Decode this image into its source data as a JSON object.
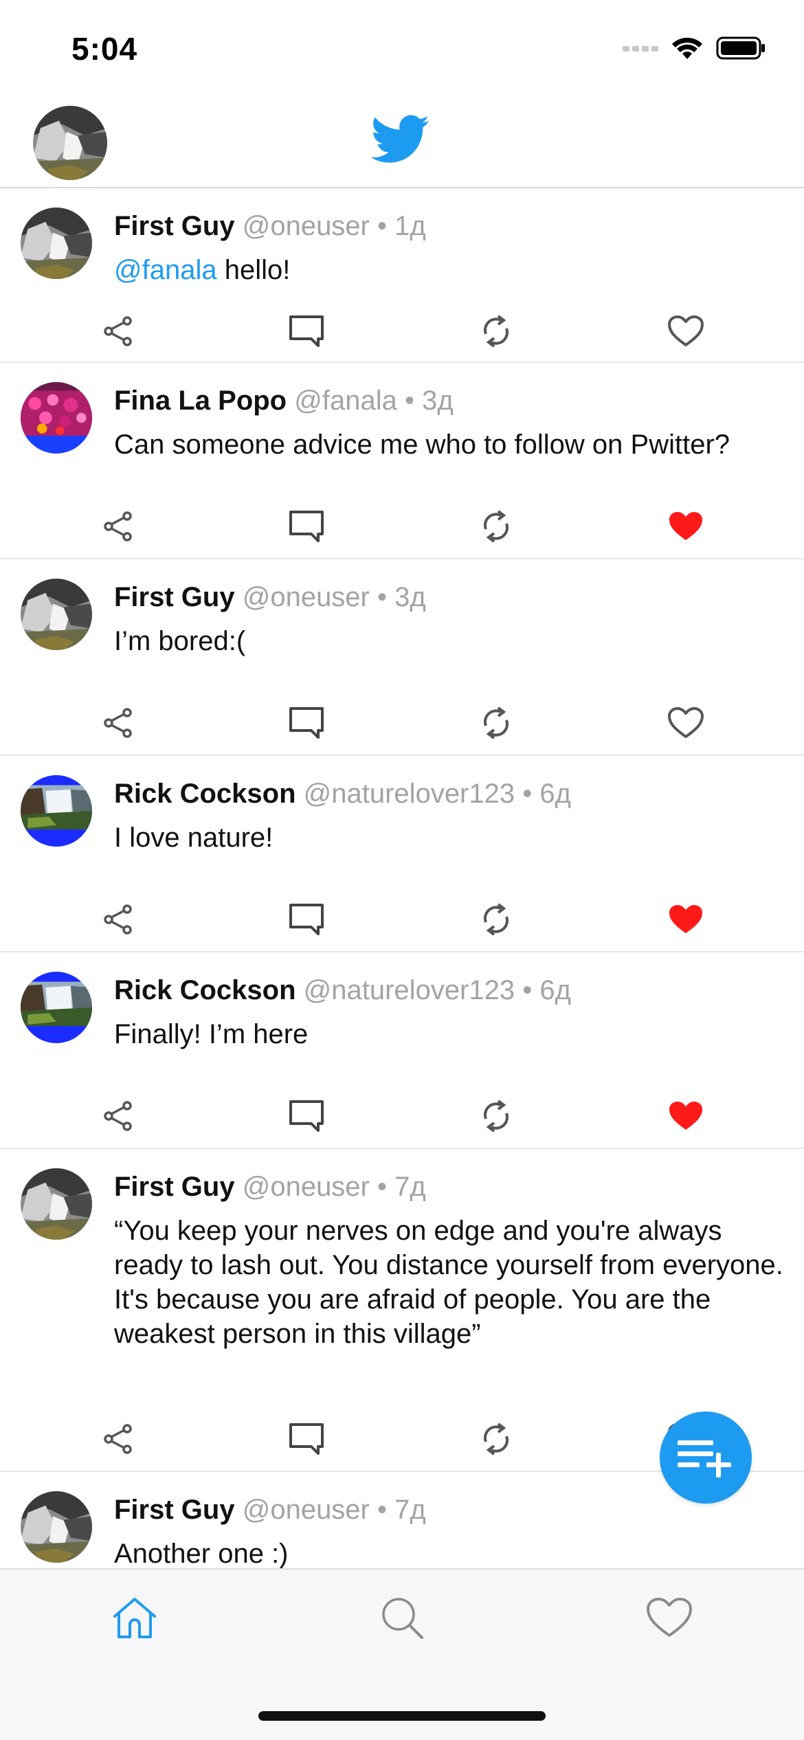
{
  "status_bar": {
    "time": "5:04"
  },
  "header": {
    "logo_icon": "twitter-bird-icon",
    "avatar_icon": "waterfall-avatar"
  },
  "colors": {
    "accent": "#1d9bf0",
    "like_active": "#ff1a1a",
    "muted_text": "#a3a3a3"
  },
  "tweets": [
    {
      "name": "First Guy",
      "handle": "@oneuser",
      "sep": "•",
      "time": "1д",
      "mention": "@fanala",
      "text": " hello!",
      "liked": false
    },
    {
      "name": "Fina La Popo",
      "handle": "@fanala",
      "sep": "•",
      "time": "3д",
      "mention": "",
      "text": "Can someone advice me who to follow on Pwitter?",
      "liked": true
    },
    {
      "name": "First Guy",
      "handle": "@oneuser",
      "sep": "•",
      "time": "3д",
      "mention": "",
      "text": "I’m bored:(",
      "liked": false
    },
    {
      "name": "Rick Cockson",
      "handle": "@naturelover123",
      "sep": "•",
      "time": "6д",
      "mention": "",
      "text": "I love nature!",
      "liked": true
    },
    {
      "name": "Rick Cockson",
      "handle": "@naturelover123",
      "sep": "•",
      "time": "6д",
      "mention": "",
      "text": "Finally! I’m here",
      "liked": true
    },
    {
      "name": "First Guy",
      "handle": "@oneuser",
      "sep": "•",
      "time": "7д",
      "mention": "",
      "text": "“You keep your nerves on edge and you're always ready to lash out. You distance yourself from everyone. It's because you are afraid of people. You are the weakest person in this village”",
      "liked": false
    },
    {
      "name": "First Guy",
      "handle": "@oneuser",
      "sep": "•",
      "time": "7д",
      "mention": "",
      "text": "Another one :)",
      "liked": false
    }
  ],
  "fab": {
    "icon": "compose-list-plus-icon"
  },
  "tabs": [
    {
      "id": "home",
      "icon": "home-icon",
      "active": true
    },
    {
      "id": "search",
      "icon": "search-icon",
      "active": false
    },
    {
      "id": "favorites",
      "icon": "heart-icon",
      "active": false
    }
  ]
}
